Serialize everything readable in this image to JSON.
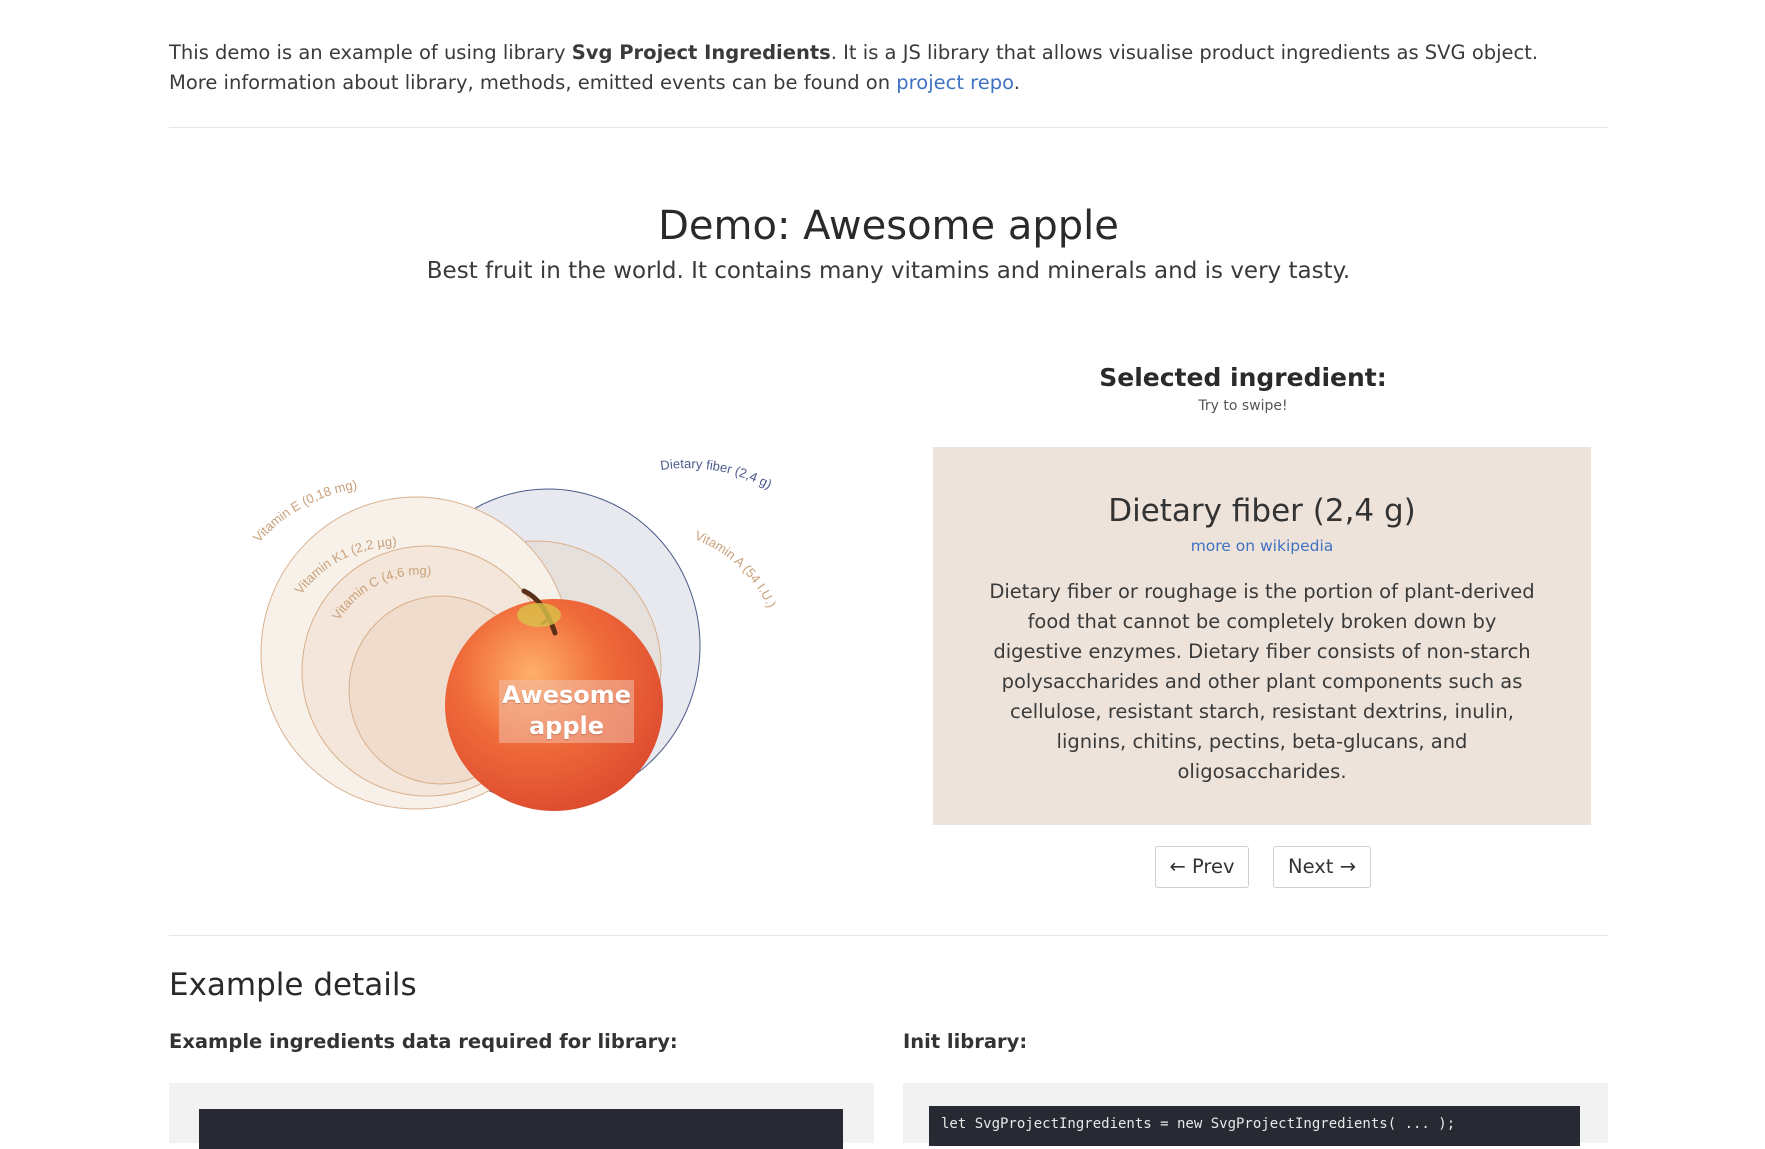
{
  "intro": {
    "line1_pre": "This demo is an example of using library ",
    "line1_bold": "Svg Project Ingredients",
    "line1_post": ". It is a JS library that allows visualise product ingredients as SVG object.",
    "line2_pre": "More information about library, methods, emitted events can be found on ",
    "line2_link": "project repo",
    "line2_post": "."
  },
  "demo": {
    "title": "Demo: Awesome apple",
    "subtitle": "Best fruit in the world. It contains many vitamins and minerals and is very tasty."
  },
  "visualization": {
    "product_label_line1": "Awesome",
    "product_label_line2": "apple",
    "ingredient_labels": {
      "vitamin_e": "Vitamin E (0,18 mg)",
      "vitamin_k1": "Vitamin K1 (2,2 µg)",
      "vitamin_c": "Vitamin C (4,6 mg)",
      "dietary_fiber": "Dietary fiber (2,4 g)",
      "vitamin_a": "Vitamin A (54 I.U.)"
    },
    "colors": {
      "vitamin_stroke": "#d8b08c",
      "fiber_stroke": "#4c5a8a",
      "fiber_fill": "#e8e9ef",
      "vitamin_fill": "#f8f1ea"
    }
  },
  "selected": {
    "heading": "Selected ingredient:",
    "hint": "Try to swipe!",
    "title": "Dietary fiber (2,4 g)",
    "link": "more on wikipedia",
    "description": "Dietary fiber or roughage is the portion of plant-derived food that cannot be completely broken down by digestive enzymes. Dietary fiber consists of non-starch polysaccharides and other plant components such as cellulose, resistant starch, resistant dextrins, inulin, lignins, chitins, pectins, beta-glucans, and oligosaccharides.",
    "card_color": "#ede3db"
  },
  "nav": {
    "prev": "← Prev",
    "next": "Next →"
  },
  "details": {
    "title": "Example details",
    "data_label": "Example ingredients data required for library:",
    "init_label": "Init library:",
    "init_code": "let SvgProjectIngredients = new SvgProjectIngredients( ... );"
  }
}
